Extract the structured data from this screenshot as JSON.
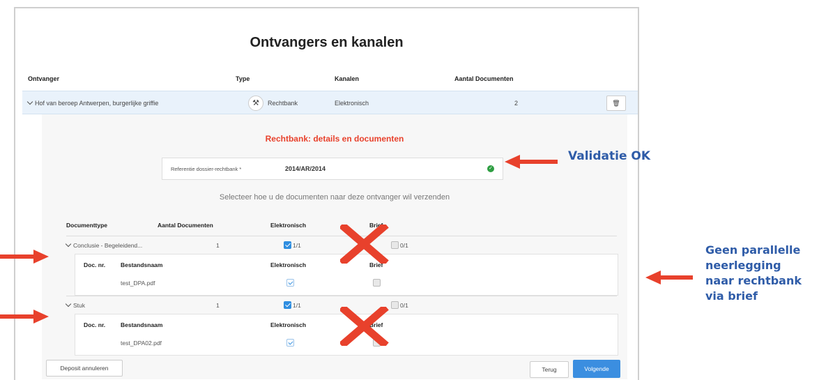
{
  "title": "Ontvangers en kanalen",
  "columns": {
    "ontvanger": "Ontvanger",
    "type": "Type",
    "kanalen": "Kanalen",
    "aantal": "Aantal Documenten"
  },
  "recipient": {
    "name": "Hof van beroep Antwerpen, burgerlijke griffie",
    "type": "Rechtbank",
    "channel": "Elektronisch",
    "count": "2",
    "type_icon": "gavel-icon",
    "delete_icon": "trash-icon"
  },
  "details": {
    "title": "Rechtbank: details en documenten",
    "reference_label": "Referentie dossier-rechtbank *",
    "reference_value": "2014/AR/2014",
    "instruction": "Selecteer hoe u de documenten naar deze ontvanger wil verzenden"
  },
  "doc_table": {
    "headers": [
      "Documenttype",
      "Aantal Documenten",
      "Elektronisch",
      "Brief"
    ],
    "groups": [
      {
        "type": "Conclusie - Begeleidend...",
        "count": "1",
        "electronic": "1/1",
        "letter": "0/1",
        "sub_headers": [
          "Doc. nr.",
          "Bestandsnaam",
          "Elektronisch",
          "Brief"
        ],
        "files": [
          {
            "name": "test_DPA.pdf",
            "electronic": true,
            "letter": false
          }
        ]
      },
      {
        "type": "Stuk",
        "count": "1",
        "electronic": "1/1",
        "letter": "0/1",
        "sub_headers": [
          "Doc. nr.",
          "Bestandsnaam",
          "Elektronisch",
          "Brief"
        ],
        "files": [
          {
            "name": "test_DPA02.pdf",
            "electronic": true,
            "letter": false
          }
        ]
      }
    ]
  },
  "buttons": {
    "cancel": "Deposit annuleren",
    "back": "Terug",
    "next": "Volgende"
  },
  "annotations": {
    "validation": "Validatie OK",
    "no_parallel": [
      "Geen parallelle",
      "neerlegging",
      "naar rechtbank",
      "via brief"
    ]
  },
  "colors": {
    "accent": "#3b8ee0",
    "section_title": "#e8412c",
    "annotation_text": "#2f5ca8",
    "annotation_arrow": "#e8412c",
    "valid": "#2e9e42"
  }
}
